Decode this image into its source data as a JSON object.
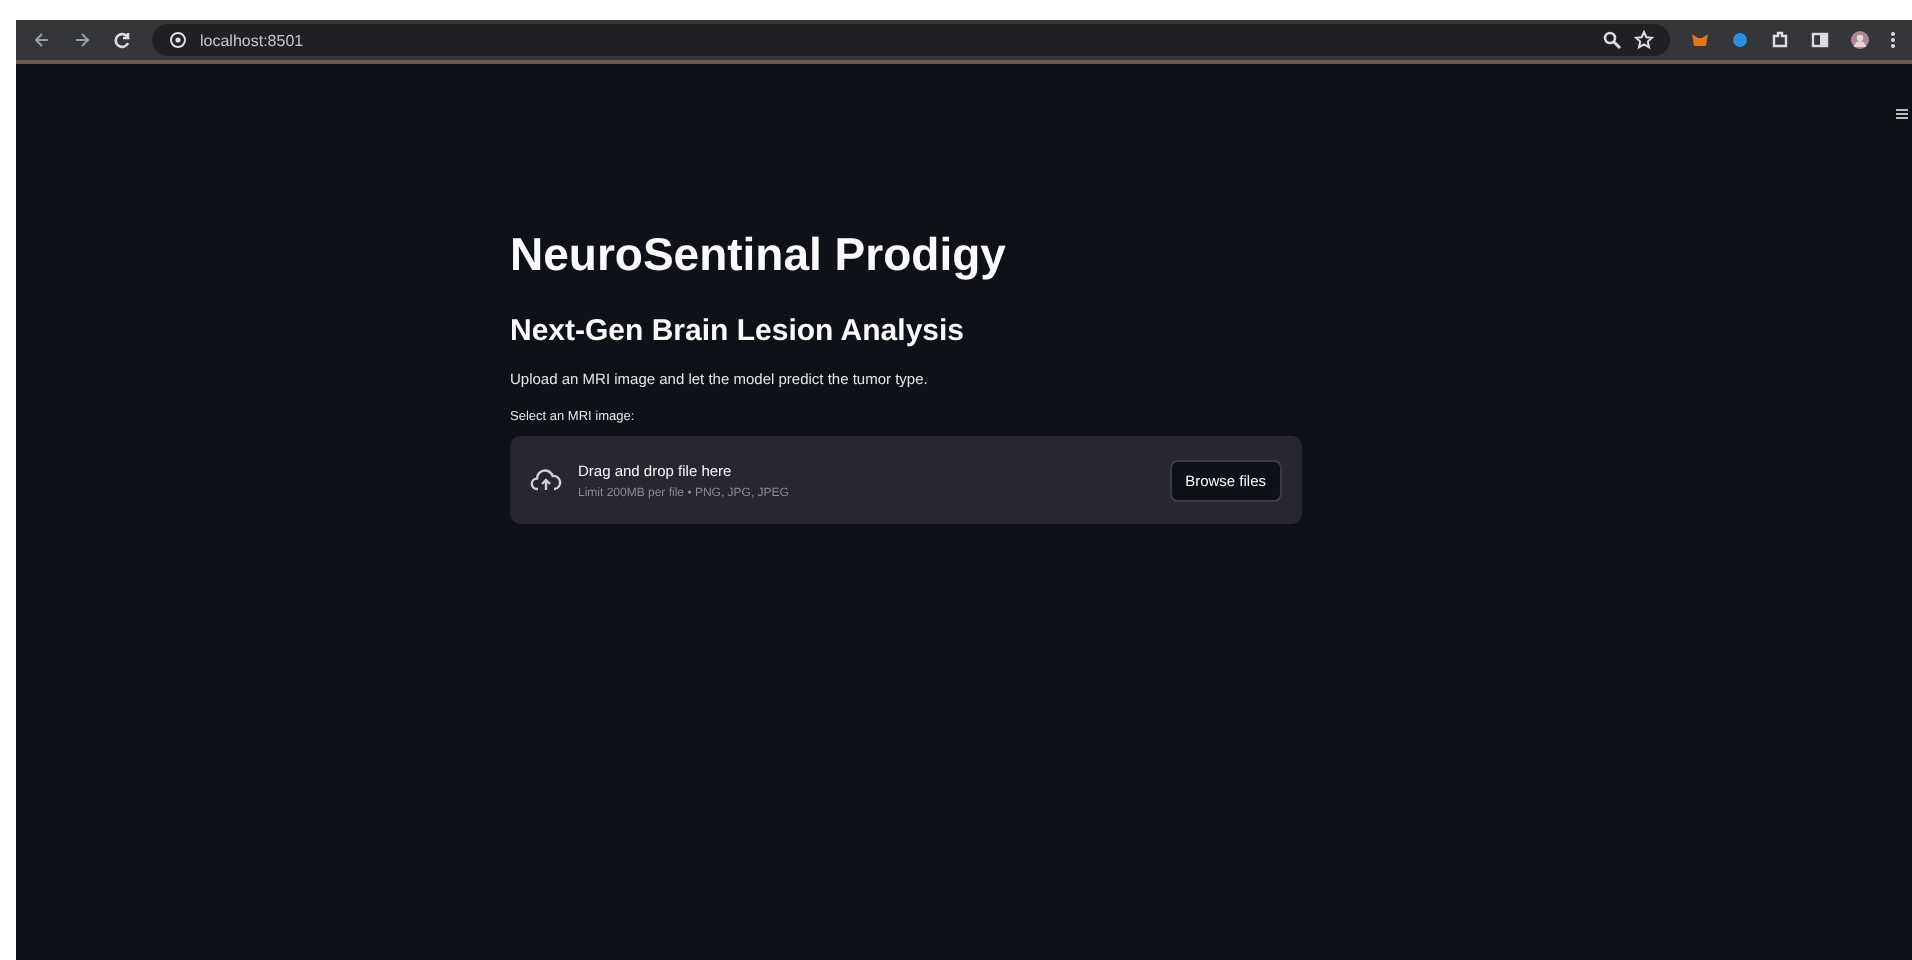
{
  "browser": {
    "url": "localhost:8501"
  },
  "page": {
    "title": "NeuroSentinal Prodigy",
    "subtitle": "Next-Gen Brain Lesion Analysis",
    "description": "Upload an MRI image and let the model predict the tumor type.",
    "uploader": {
      "label": "Select an MRI image:",
      "dropzone_title": "Drag and drop file here",
      "dropzone_hint": "Limit 200MB per file • PNG, JPG, JPEG",
      "button": "Browse files"
    }
  }
}
